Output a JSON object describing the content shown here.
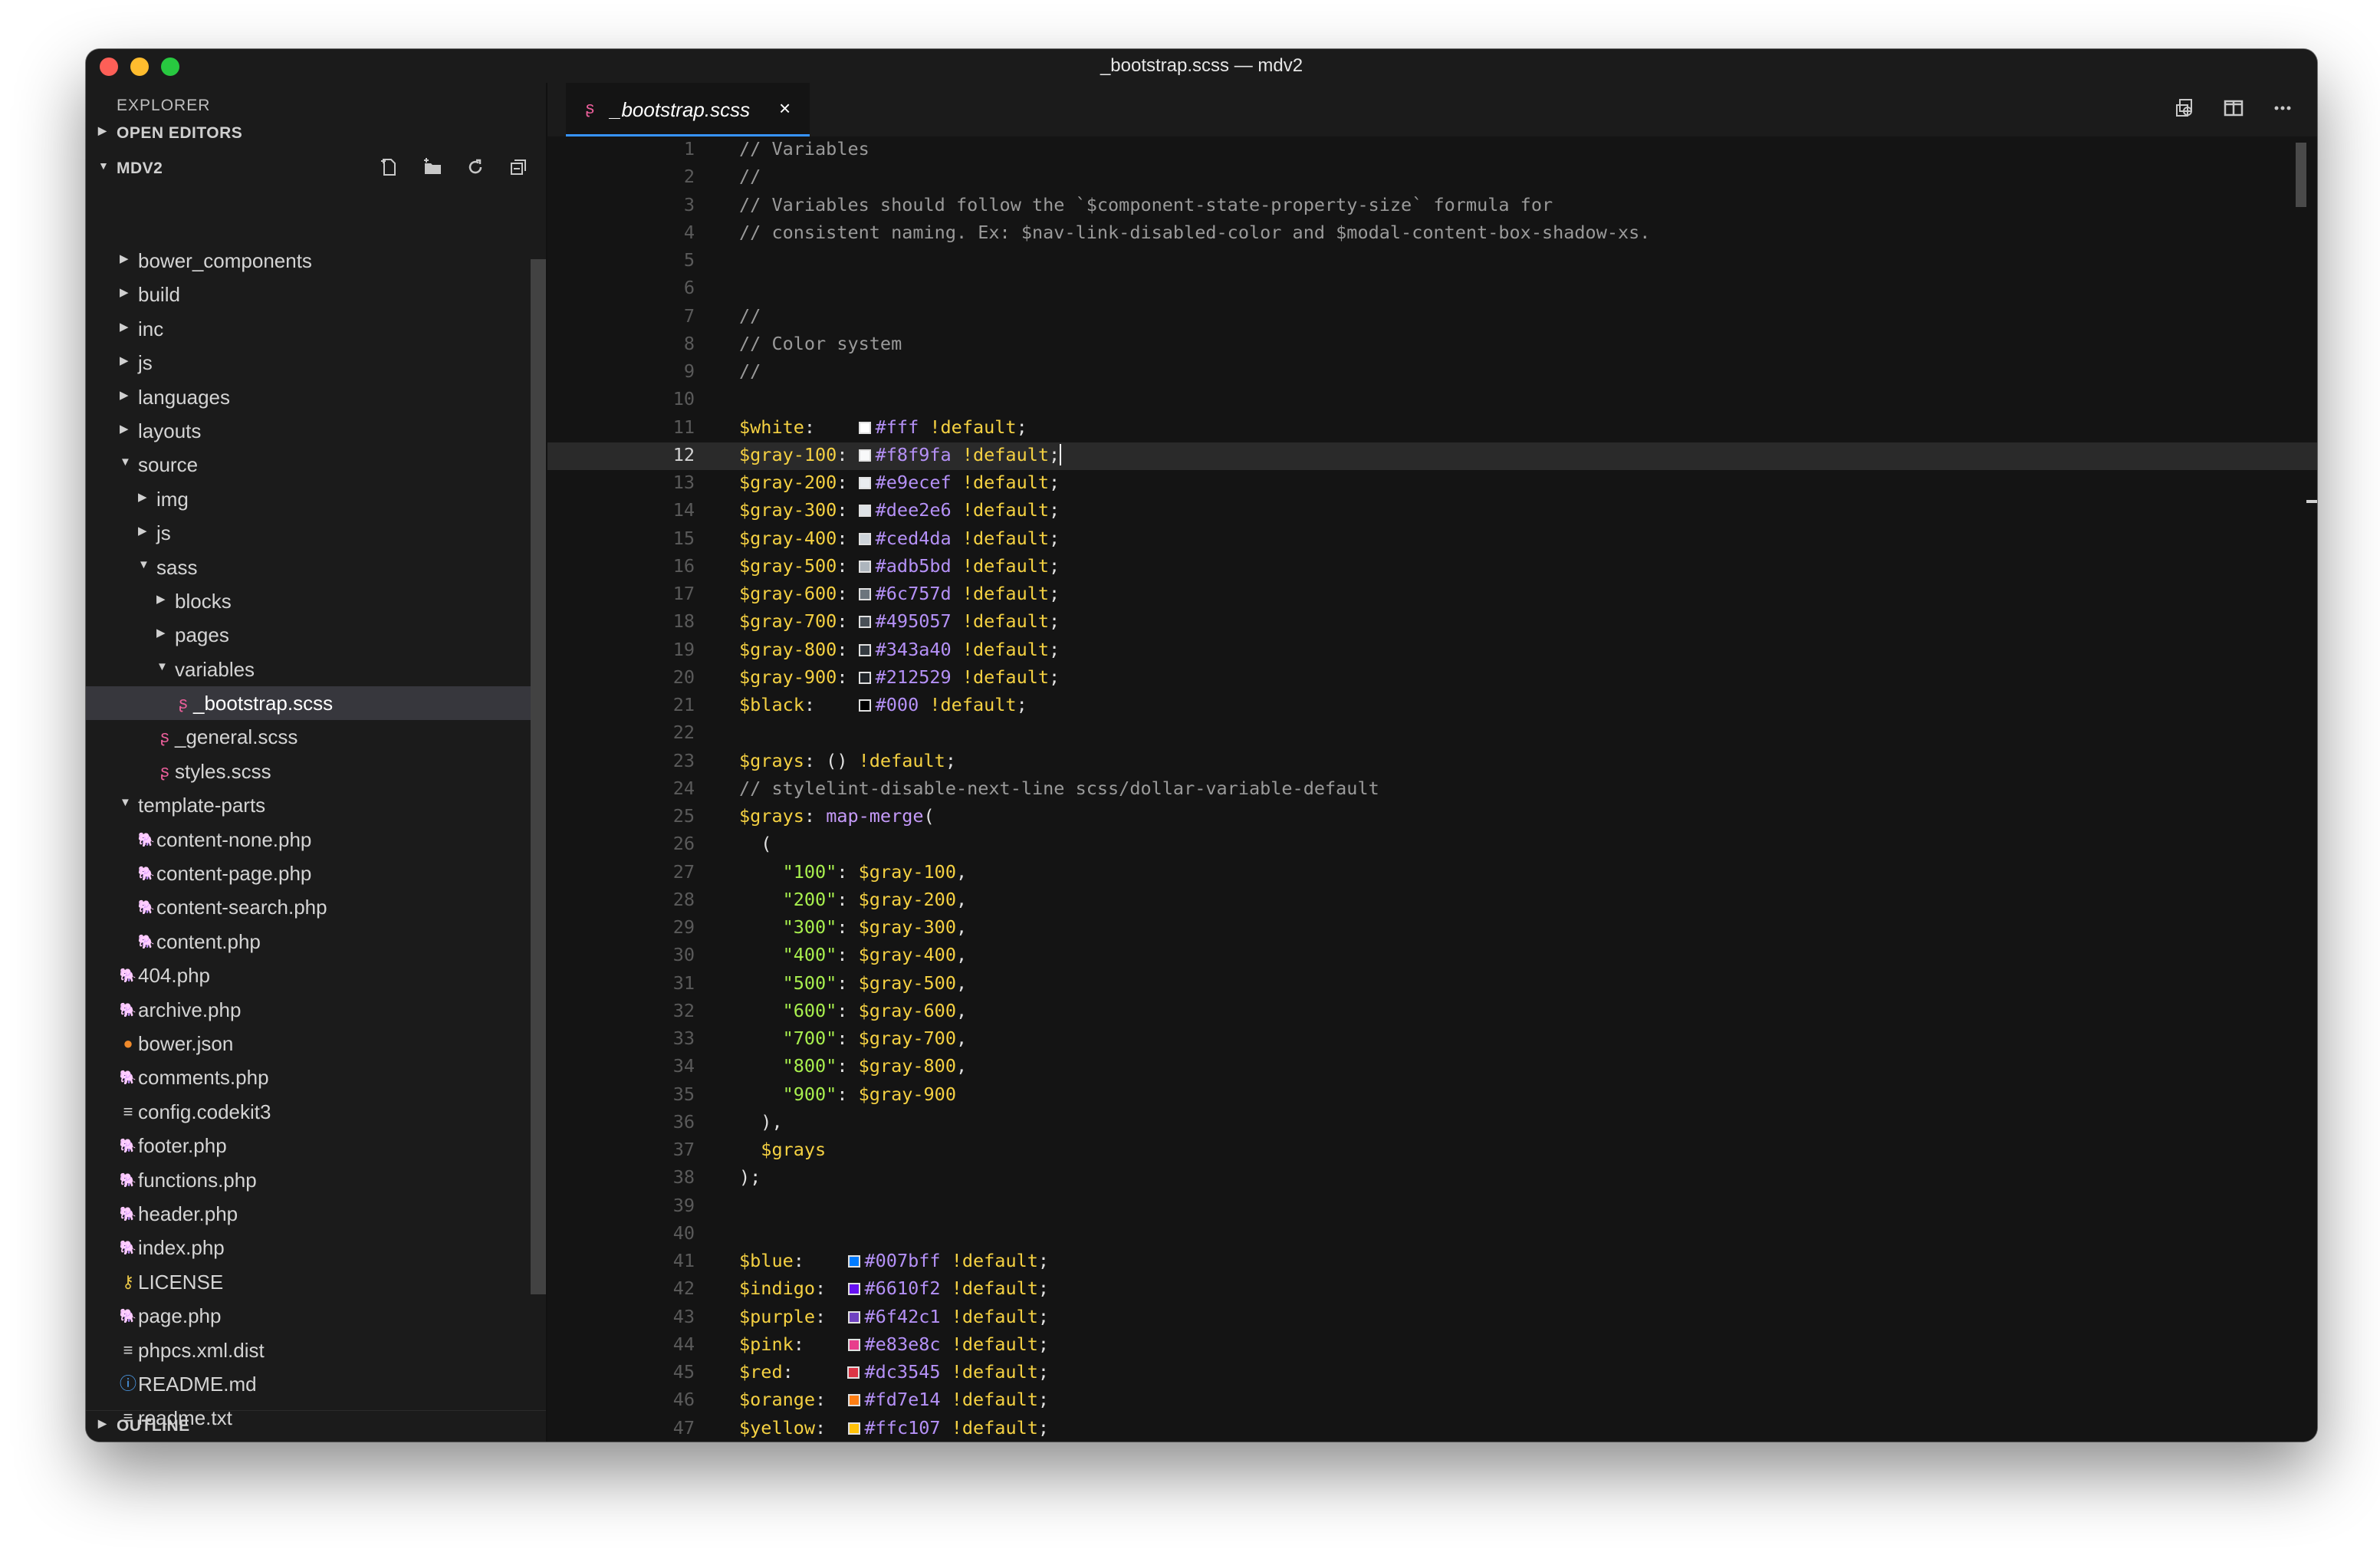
{
  "window": {
    "title": "_bootstrap.scss — mdv2"
  },
  "sidebar": {
    "title": "EXPLORER",
    "open_editors": "OPEN EDITORS",
    "project": "MDV2",
    "outline": "OUTLINE",
    "tree": [
      {
        "name": "bower_components",
        "depth": 0,
        "type": "folder",
        "open": false
      },
      {
        "name": "build",
        "depth": 0,
        "type": "folder",
        "open": false
      },
      {
        "name": "inc",
        "depth": 0,
        "type": "folder",
        "open": false
      },
      {
        "name": "js",
        "depth": 0,
        "type": "folder",
        "open": false
      },
      {
        "name": "languages",
        "depth": 0,
        "type": "folder",
        "open": false
      },
      {
        "name": "layouts",
        "depth": 0,
        "type": "folder",
        "open": false
      },
      {
        "name": "source",
        "depth": 0,
        "type": "folder",
        "open": true
      },
      {
        "name": "img",
        "depth": 1,
        "type": "folder",
        "open": false
      },
      {
        "name": "js",
        "depth": 1,
        "type": "folder",
        "open": false
      },
      {
        "name": "sass",
        "depth": 1,
        "type": "folder",
        "open": true
      },
      {
        "name": "blocks",
        "depth": 2,
        "type": "folder",
        "open": false
      },
      {
        "name": "pages",
        "depth": 2,
        "type": "folder",
        "open": false
      },
      {
        "name": "variables",
        "depth": 2,
        "type": "folder",
        "open": true
      },
      {
        "name": "_bootstrap.scss",
        "depth": 3,
        "type": "scss",
        "selected": true
      },
      {
        "name": "_general.scss",
        "depth": 2,
        "type": "scss"
      },
      {
        "name": "styles.scss",
        "depth": 2,
        "type": "scss"
      },
      {
        "name": "template-parts",
        "depth": 0,
        "type": "folder",
        "open": true
      },
      {
        "name": "content-none.php",
        "depth": 1,
        "type": "php"
      },
      {
        "name": "content-page.php",
        "depth": 1,
        "type": "php"
      },
      {
        "name": "content-search.php",
        "depth": 1,
        "type": "php"
      },
      {
        "name": "content.php",
        "depth": 1,
        "type": "php"
      },
      {
        "name": "404.php",
        "depth": 0,
        "type": "php"
      },
      {
        "name": "archive.php",
        "depth": 0,
        "type": "php"
      },
      {
        "name": "bower.json",
        "depth": 0,
        "type": "bower"
      },
      {
        "name": "comments.php",
        "depth": 0,
        "type": "php"
      },
      {
        "name": "config.codekit3",
        "depth": 0,
        "type": "text"
      },
      {
        "name": "footer.php",
        "depth": 0,
        "type": "php"
      },
      {
        "name": "functions.php",
        "depth": 0,
        "type": "php"
      },
      {
        "name": "header.php",
        "depth": 0,
        "type": "php"
      },
      {
        "name": "index.php",
        "depth": 0,
        "type": "php"
      },
      {
        "name": "LICENSE",
        "depth": 0,
        "type": "license"
      },
      {
        "name": "page.php",
        "depth": 0,
        "type": "php"
      },
      {
        "name": "phpcs.xml.dist",
        "depth": 0,
        "type": "text"
      },
      {
        "name": "README.md",
        "depth": 0,
        "type": "info"
      },
      {
        "name": "readme.txt",
        "depth": 0,
        "type": "text"
      }
    ]
  },
  "editor": {
    "tab": {
      "label": "_bootstrap.scss",
      "close": "×"
    },
    "current_line": 12,
    "lines": [
      {
        "n": 1,
        "t": [
          [
            "c",
            "// Variables"
          ]
        ]
      },
      {
        "n": 2,
        "t": [
          [
            "c",
            "//"
          ]
        ]
      },
      {
        "n": 3,
        "t": [
          [
            "c",
            "// Variables should follow the `$component-state-property-size` formula for"
          ]
        ]
      },
      {
        "n": 4,
        "t": [
          [
            "c",
            "// consistent naming. Ex: $nav-link-disabled-color and $modal-content-box-shadow-xs."
          ]
        ]
      },
      {
        "n": 5,
        "t": []
      },
      {
        "n": 6,
        "t": []
      },
      {
        "n": 7,
        "t": [
          [
            "c",
            "//"
          ]
        ]
      },
      {
        "n": 8,
        "t": [
          [
            "c",
            "// Color system"
          ]
        ]
      },
      {
        "n": 9,
        "t": [
          [
            "c",
            "//"
          ]
        ]
      },
      {
        "n": 10,
        "t": []
      },
      {
        "n": 11,
        "t": [
          [
            "v",
            "$white"
          ],
          [
            "p",
            ":    "
          ],
          [
            "s",
            "#ffffff"
          ],
          [
            "h",
            "#fff"
          ],
          [
            "p",
            " "
          ],
          [
            "k",
            "!default"
          ],
          [
            "p",
            ";"
          ]
        ]
      },
      {
        "n": 12,
        "t": [
          [
            "v",
            "$gray-100"
          ],
          [
            "p",
            ": "
          ],
          [
            "s",
            "#f8f9fa"
          ],
          [
            "h",
            "#f8f9fa"
          ],
          [
            "p",
            " "
          ],
          [
            "k",
            "!default"
          ],
          [
            "p",
            ";"
          ],
          [
            "cur",
            ""
          ]
        ]
      },
      {
        "n": 13,
        "t": [
          [
            "v",
            "$gray-200"
          ],
          [
            "p",
            ": "
          ],
          [
            "s",
            "#e9ecef"
          ],
          [
            "h",
            "#e9ecef"
          ],
          [
            "p",
            " "
          ],
          [
            "k",
            "!default"
          ],
          [
            "p",
            ";"
          ]
        ]
      },
      {
        "n": 14,
        "t": [
          [
            "v",
            "$gray-300"
          ],
          [
            "p",
            ": "
          ],
          [
            "s",
            "#dee2e6"
          ],
          [
            "h",
            "#dee2e6"
          ],
          [
            "p",
            " "
          ],
          [
            "k",
            "!default"
          ],
          [
            "p",
            ";"
          ]
        ]
      },
      {
        "n": 15,
        "t": [
          [
            "v",
            "$gray-400"
          ],
          [
            "p",
            ": "
          ],
          [
            "s",
            "#ced4da"
          ],
          [
            "h",
            "#ced4da"
          ],
          [
            "p",
            " "
          ],
          [
            "k",
            "!default"
          ],
          [
            "p",
            ";"
          ]
        ]
      },
      {
        "n": 16,
        "t": [
          [
            "v",
            "$gray-500"
          ],
          [
            "p",
            ": "
          ],
          [
            "s",
            "#adb5bd"
          ],
          [
            "h",
            "#adb5bd"
          ],
          [
            "p",
            " "
          ],
          [
            "k",
            "!default"
          ],
          [
            "p",
            ";"
          ]
        ]
      },
      {
        "n": 17,
        "t": [
          [
            "v",
            "$gray-600"
          ],
          [
            "p",
            ": "
          ],
          [
            "s",
            "#6c757d"
          ],
          [
            "h",
            "#6c757d"
          ],
          [
            "p",
            " "
          ],
          [
            "k",
            "!default"
          ],
          [
            "p",
            ";"
          ]
        ]
      },
      {
        "n": 18,
        "t": [
          [
            "v",
            "$gray-700"
          ],
          [
            "p",
            ": "
          ],
          [
            "s",
            "#495057"
          ],
          [
            "h",
            "#495057"
          ],
          [
            "p",
            " "
          ],
          [
            "k",
            "!default"
          ],
          [
            "p",
            ";"
          ]
        ]
      },
      {
        "n": 19,
        "t": [
          [
            "v",
            "$gray-800"
          ],
          [
            "p",
            ": "
          ],
          [
            "s",
            "#343a40"
          ],
          [
            "h",
            "#343a40"
          ],
          [
            "p",
            " "
          ],
          [
            "k",
            "!default"
          ],
          [
            "p",
            ";"
          ]
        ]
      },
      {
        "n": 20,
        "t": [
          [
            "v",
            "$gray-900"
          ],
          [
            "p",
            ": "
          ],
          [
            "s",
            "#212529"
          ],
          [
            "h",
            "#212529"
          ],
          [
            "p",
            " "
          ],
          [
            "k",
            "!default"
          ],
          [
            "p",
            ";"
          ]
        ]
      },
      {
        "n": 21,
        "t": [
          [
            "v",
            "$black"
          ],
          [
            "p",
            ":    "
          ],
          [
            "s",
            "#000000"
          ],
          [
            "h",
            "#000"
          ],
          [
            "p",
            " "
          ],
          [
            "k",
            "!default"
          ],
          [
            "p",
            ";"
          ]
        ]
      },
      {
        "n": 22,
        "t": []
      },
      {
        "n": 23,
        "t": [
          [
            "v",
            "$grays"
          ],
          [
            "p",
            ": () "
          ],
          [
            "k",
            "!default"
          ],
          [
            "p",
            ";"
          ]
        ]
      },
      {
        "n": 24,
        "t": [
          [
            "c",
            "// stylelint-disable-next-line scss/dollar-variable-default"
          ]
        ]
      },
      {
        "n": 25,
        "t": [
          [
            "v",
            "$grays"
          ],
          [
            "p",
            ": "
          ],
          [
            "f",
            "map-merge"
          ],
          [
            "p",
            "("
          ]
        ]
      },
      {
        "n": 26,
        "t": [
          [
            "p",
            "  ("
          ]
        ]
      },
      {
        "n": 27,
        "t": [
          [
            "p",
            "    "
          ],
          [
            "q",
            "\"100\""
          ],
          [
            "p",
            ": "
          ],
          [
            "v",
            "$gray-100"
          ],
          [
            "p",
            ","
          ]
        ]
      },
      {
        "n": 28,
        "t": [
          [
            "p",
            "    "
          ],
          [
            "q",
            "\"200\""
          ],
          [
            "p",
            ": "
          ],
          [
            "v",
            "$gray-200"
          ],
          [
            "p",
            ","
          ]
        ]
      },
      {
        "n": 29,
        "t": [
          [
            "p",
            "    "
          ],
          [
            "q",
            "\"300\""
          ],
          [
            "p",
            ": "
          ],
          [
            "v",
            "$gray-300"
          ],
          [
            "p",
            ","
          ]
        ]
      },
      {
        "n": 30,
        "t": [
          [
            "p",
            "    "
          ],
          [
            "q",
            "\"400\""
          ],
          [
            "p",
            ": "
          ],
          [
            "v",
            "$gray-400"
          ],
          [
            "p",
            ","
          ]
        ]
      },
      {
        "n": 31,
        "t": [
          [
            "p",
            "    "
          ],
          [
            "q",
            "\"500\""
          ],
          [
            "p",
            ": "
          ],
          [
            "v",
            "$gray-500"
          ],
          [
            "p",
            ","
          ]
        ]
      },
      {
        "n": 32,
        "t": [
          [
            "p",
            "    "
          ],
          [
            "q",
            "\"600\""
          ],
          [
            "p",
            ": "
          ],
          [
            "v",
            "$gray-600"
          ],
          [
            "p",
            ","
          ]
        ]
      },
      {
        "n": 33,
        "t": [
          [
            "p",
            "    "
          ],
          [
            "q",
            "\"700\""
          ],
          [
            "p",
            ": "
          ],
          [
            "v",
            "$gray-700"
          ],
          [
            "p",
            ","
          ]
        ]
      },
      {
        "n": 34,
        "t": [
          [
            "p",
            "    "
          ],
          [
            "q",
            "\"800\""
          ],
          [
            "p",
            ": "
          ],
          [
            "v",
            "$gray-800"
          ],
          [
            "p",
            ","
          ]
        ]
      },
      {
        "n": 35,
        "t": [
          [
            "p",
            "    "
          ],
          [
            "q",
            "\"900\""
          ],
          [
            "p",
            ": "
          ],
          [
            "v",
            "$gray-900"
          ]
        ]
      },
      {
        "n": 36,
        "t": [
          [
            "p",
            "  ),"
          ]
        ]
      },
      {
        "n": 37,
        "t": [
          [
            "p",
            "  "
          ],
          [
            "v",
            "$grays"
          ]
        ]
      },
      {
        "n": 38,
        "t": [
          [
            "p",
            ");"
          ]
        ]
      },
      {
        "n": 39,
        "t": []
      },
      {
        "n": 40,
        "t": []
      },
      {
        "n": 41,
        "t": [
          [
            "v",
            "$blue"
          ],
          [
            "p",
            ":    "
          ],
          [
            "s",
            "#007bff"
          ],
          [
            "h",
            "#007bff"
          ],
          [
            "p",
            " "
          ],
          [
            "k",
            "!default"
          ],
          [
            "p",
            ";"
          ]
        ]
      },
      {
        "n": 42,
        "t": [
          [
            "v",
            "$indigo"
          ],
          [
            "p",
            ":  "
          ],
          [
            "s",
            "#6610f2"
          ],
          [
            "h",
            "#6610f2"
          ],
          [
            "p",
            " "
          ],
          [
            "k",
            "!default"
          ],
          [
            "p",
            ";"
          ]
        ]
      },
      {
        "n": 43,
        "t": [
          [
            "v",
            "$purple"
          ],
          [
            "p",
            ":  "
          ],
          [
            "s",
            "#6f42c1"
          ],
          [
            "h",
            "#6f42c1"
          ],
          [
            "p",
            " "
          ],
          [
            "k",
            "!default"
          ],
          [
            "p",
            ";"
          ]
        ]
      },
      {
        "n": 44,
        "t": [
          [
            "v",
            "$pink"
          ],
          [
            "p",
            ":    "
          ],
          [
            "s",
            "#e83e8c"
          ],
          [
            "h",
            "#e83e8c"
          ],
          [
            "p",
            " "
          ],
          [
            "k",
            "!default"
          ],
          [
            "p",
            ";"
          ]
        ]
      },
      {
        "n": 45,
        "t": [
          [
            "v",
            "$red"
          ],
          [
            "p",
            ":     "
          ],
          [
            "s",
            "#dc3545"
          ],
          [
            "h",
            "#dc3545"
          ],
          [
            "p",
            " "
          ],
          [
            "k",
            "!default"
          ],
          [
            "p",
            ";"
          ]
        ]
      },
      {
        "n": 46,
        "t": [
          [
            "v",
            "$orange"
          ],
          [
            "p",
            ":  "
          ],
          [
            "s",
            "#fd7e14"
          ],
          [
            "h",
            "#fd7e14"
          ],
          [
            "p",
            " "
          ],
          [
            "k",
            "!default"
          ],
          [
            "p",
            ";"
          ]
        ]
      },
      {
        "n": 47,
        "t": [
          [
            "v",
            "$yellow"
          ],
          [
            "p",
            ":  "
          ],
          [
            "s",
            "#ffc107"
          ],
          [
            "h",
            "#ffc107"
          ],
          [
            "p",
            " "
          ],
          [
            "k",
            "!default"
          ],
          [
            "p",
            ";"
          ]
        ]
      }
    ]
  },
  "icons": {
    "folder_closed": "chevron-right-icon",
    "folder_open": "chevron-down-icon",
    "scss": "sass-file-icon",
    "php": "php-file-icon",
    "bower": "bower-file-icon",
    "text": "text-file-icon",
    "license": "license-file-icon",
    "info": "info-file-icon",
    "new_file": "new-file-icon",
    "new_folder": "new-folder-icon",
    "refresh": "refresh-icon",
    "collapse": "collapse-all-icon",
    "compare": "open-changes-icon",
    "split": "split-editor-icon",
    "more": "more-actions-icon"
  },
  "colors": {
    "variable": "#f5d142",
    "hex": "#b591f7",
    "comment": "#9a9a9a",
    "string": "#a8ef4e",
    "function": "#c59af9",
    "tab_accent": "#3794ff",
    "scss_icon": "#ec5f9b",
    "php_icon": "#a98ce8"
  }
}
